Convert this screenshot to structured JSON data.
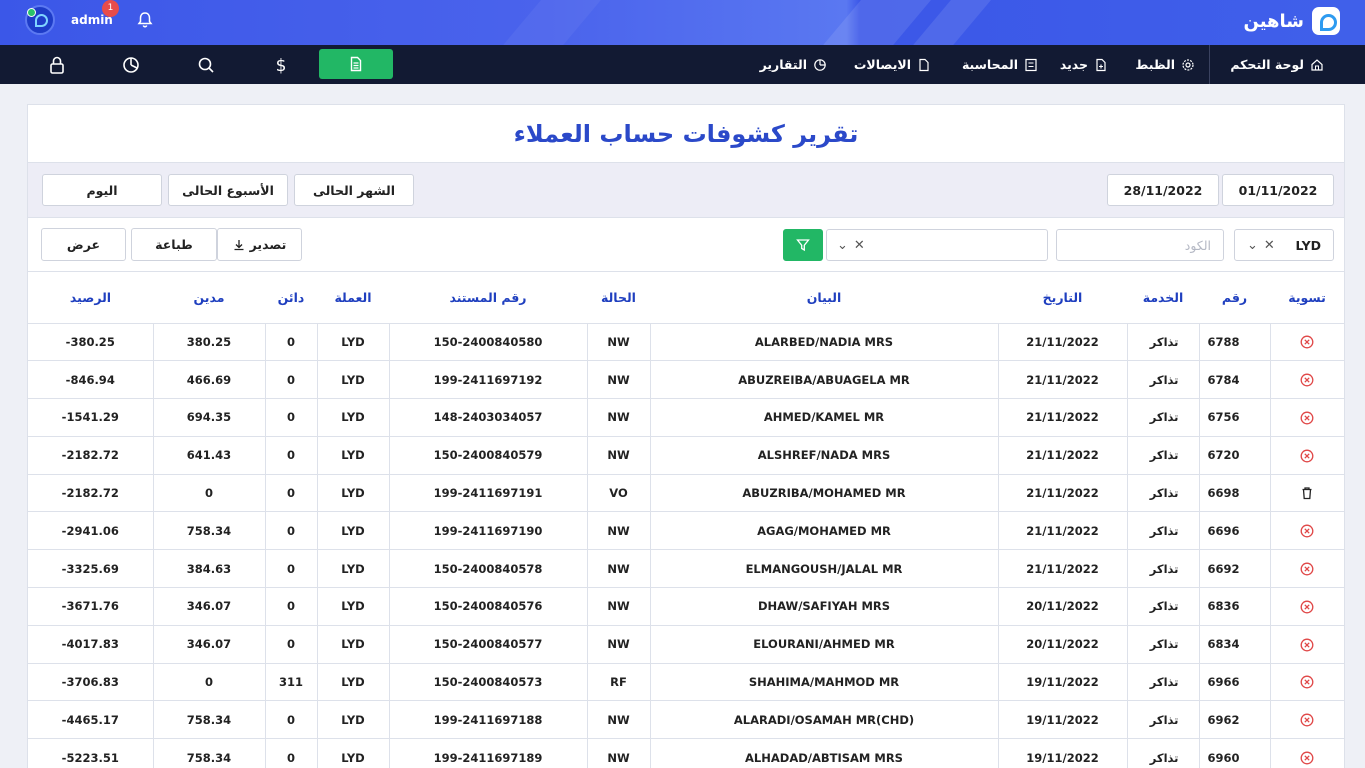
{
  "app": {
    "brand": "شاهين",
    "user": "admin",
    "notifications": "1"
  },
  "nav": {
    "dashboard": "لوحة التحكم",
    "settings": "الظبط",
    "new": "جديد",
    "accounting": "المحاسبة",
    "receipts": "الايصالات",
    "reports": "التقارير"
  },
  "page": {
    "title": "تقرير كشوفات حساب العملاء"
  },
  "filters": {
    "date_from": "01/11/2022",
    "date_to": "28/11/2022",
    "current_month": "الشهر الحالى",
    "current_week": "الأسبوع الحالى",
    "today": "اليوم",
    "currency": "LYD",
    "code_placeholder": "الكود",
    "export": "تصدير",
    "print": "طباعة",
    "view": "عرض"
  },
  "table": {
    "headers": {
      "settle": "تسوية",
      "number": "رقم",
      "service": "الخدمة",
      "date": "التاريخ",
      "statement": "البيان",
      "status": "الحالة",
      "doc_no": "رقم المستند",
      "currency": "العملة",
      "credit": "دائن",
      "debit": "مدين",
      "balance": "الرصيد"
    },
    "rows": [
      {
        "icon": "cancel-icon",
        "number": "6788",
        "service": "تذاكر",
        "date": "21/11/2022",
        "statement": "ALARBED/NADIA MRS",
        "status": "NW",
        "doc_no": "150-2400840580",
        "currency": "LYD",
        "credit": "0",
        "debit": "380.25",
        "balance": "380.25-"
      },
      {
        "icon": "cancel-icon",
        "number": "6784",
        "service": "تذاكر",
        "date": "21/11/2022",
        "statement": "ABUZREIBA/ABUAGELA MR",
        "status": "NW",
        "doc_no": "199-2411697192",
        "currency": "LYD",
        "credit": "0",
        "debit": "466.69",
        "balance": "846.94-"
      },
      {
        "icon": "cancel-icon",
        "number": "6756",
        "service": "تذاكر",
        "date": "21/11/2022",
        "statement": "AHMED/KAMEL MR",
        "status": "NW",
        "doc_no": "148-2403034057",
        "currency": "LYD",
        "credit": "0",
        "debit": "694.35",
        "balance": "1541.29-"
      },
      {
        "icon": "cancel-icon",
        "number": "6720",
        "service": "تذاكر",
        "date": "21/11/2022",
        "statement": "ALSHREF/NADA MRS",
        "status": "NW",
        "doc_no": "150-2400840579",
        "currency": "LYD",
        "credit": "0",
        "debit": "641.43",
        "balance": "2182.72-"
      },
      {
        "icon": "trash-icon",
        "number": "6698",
        "service": "تذاكر",
        "date": "21/11/2022",
        "statement": "ABUZRIBA/MOHAMED MR",
        "status": "VO",
        "doc_no": "199-2411697191",
        "currency": "LYD",
        "credit": "0",
        "debit": "0",
        "balance": "2182.72-"
      },
      {
        "icon": "cancel-icon",
        "number": "6696",
        "service": "تذاكر",
        "date": "21/11/2022",
        "statement": "AGAG/MOHAMED MR",
        "status": "NW",
        "doc_no": "199-2411697190",
        "currency": "LYD",
        "credit": "0",
        "debit": "758.34",
        "balance": "2941.06-"
      },
      {
        "icon": "cancel-icon",
        "number": "6692",
        "service": "تذاكر",
        "date": "21/11/2022",
        "statement": "ELMANGOUSH/JALAL MR",
        "status": "NW",
        "doc_no": "150-2400840578",
        "currency": "LYD",
        "credit": "0",
        "debit": "384.63",
        "balance": "3325.69-"
      },
      {
        "icon": "cancel-icon",
        "number": "6836",
        "service": "تذاكر",
        "date": "20/11/2022",
        "statement": "DHAW/SAFIYAH MRS",
        "status": "NW",
        "doc_no": "150-2400840576",
        "currency": "LYD",
        "credit": "0",
        "debit": "346.07",
        "balance": "3671.76-"
      },
      {
        "icon": "cancel-icon",
        "number": "6834",
        "service": "تذاكر",
        "date": "20/11/2022",
        "statement": "ELOURANI/AHMED MR",
        "status": "NW",
        "doc_no": "150-2400840577",
        "currency": "LYD",
        "credit": "0",
        "debit": "346.07",
        "balance": "4017.83-"
      },
      {
        "icon": "cancel-icon",
        "number": "6966",
        "service": "تذاكر",
        "date": "19/11/2022",
        "statement": "SHAHIMA/MAHMOD MR",
        "status": "RF",
        "doc_no": "150-2400840573",
        "currency": "LYD",
        "credit": "311",
        "debit": "0",
        "balance": "3706.83-"
      },
      {
        "icon": "cancel-icon",
        "number": "6962",
        "service": "تذاكر",
        "date": "19/11/2022",
        "statement": "ALARADI/OSAMAH MR(CHD)",
        "status": "NW",
        "doc_no": "199-2411697188",
        "currency": "LYD",
        "credit": "0",
        "debit": "758.34",
        "balance": "4465.17-"
      },
      {
        "icon": "cancel-icon",
        "number": "6960",
        "service": "تذاكر",
        "date": "19/11/2022",
        "statement": "ALHADAD/ABTISAM MRS",
        "status": "NW",
        "doc_no": "199-2411697189",
        "currency": "LYD",
        "credit": "0",
        "debit": "758.34",
        "balance": "5223.51-"
      }
    ]
  },
  "colors": {
    "header_blue": "#3b57e8",
    "nav_dark": "#121a33",
    "accent_green": "#22b765",
    "title_blue": "#2b49c9",
    "cancel_red": "#e04848"
  }
}
